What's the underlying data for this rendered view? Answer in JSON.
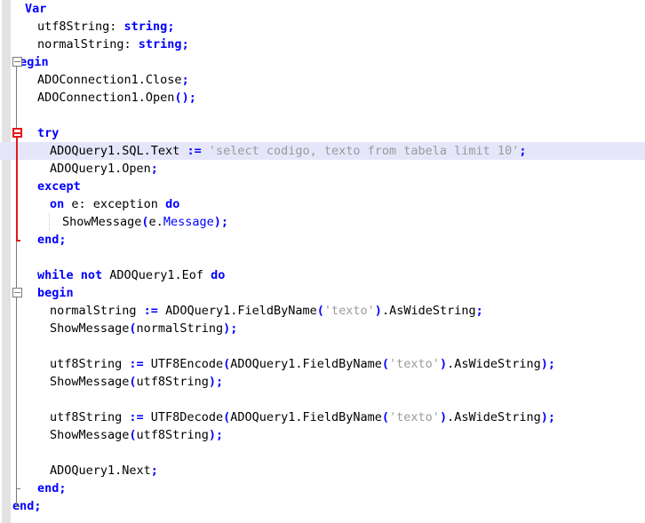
{
  "editor": {
    "name": "code-editor",
    "language": "Delphi / Object Pascal",
    "colors": {
      "background": "#ffffff",
      "gutter": "#e2e2e2",
      "keyword": "#0000ff",
      "string": "#9a9a9a",
      "identifier": "#000000",
      "punctuation": "#0000ff",
      "current_line_highlight": "#e6e6fa",
      "fold_line_gray": "#7a7a7a",
      "fold_line_red": "#e01b1b"
    },
    "highlighted_line_number": 8
  },
  "lines": [
    {
      "n": 1,
      "indent": 1,
      "highlight": false,
      "tokens": [
        {
          "t": "kw",
          "v": "Var"
        }
      ]
    },
    {
      "n": 2,
      "indent": 2,
      "highlight": false,
      "tokens": [
        {
          "t": "id",
          "v": "utf8String: "
        },
        {
          "t": "kw",
          "v": "string"
        },
        {
          "t": "pun",
          "v": ";"
        }
      ]
    },
    {
      "n": 3,
      "indent": 2,
      "highlight": false,
      "tokens": [
        {
          "t": "id",
          "v": "normalString: "
        },
        {
          "t": "kw",
          "v": "string"
        },
        {
          "t": "pun",
          "v": ";"
        }
      ]
    },
    {
      "n": 4,
      "indent": 0,
      "highlight": false,
      "tokens": [
        {
          "t": "kw",
          "v": "begin"
        }
      ]
    },
    {
      "n": 5,
      "indent": 2,
      "highlight": false,
      "tokens": [
        {
          "t": "id",
          "v": "ADOConnection1.Close"
        },
        {
          "t": "pun",
          "v": ";"
        }
      ]
    },
    {
      "n": 6,
      "indent": 2,
      "highlight": false,
      "tokens": [
        {
          "t": "id",
          "v": "ADOConnection1.Open"
        },
        {
          "t": "pun",
          "v": "();"
        }
      ]
    },
    {
      "n": 7,
      "indent": 0,
      "highlight": false,
      "tokens": []
    },
    {
      "n": 8,
      "indent": 2,
      "highlight": false,
      "tokens": [
        {
          "t": "kw",
          "v": "try"
        }
      ]
    },
    {
      "n": 9,
      "indent": 3,
      "highlight": true,
      "tokens": [
        {
          "t": "id",
          "v": "ADOQuery1.SQL.Text "
        },
        {
          "t": "pun",
          "v": ":= "
        },
        {
          "t": "str",
          "v": "'select codigo, texto from tabela limit 10'"
        },
        {
          "t": "pun",
          "v": ";"
        }
      ]
    },
    {
      "n": 10,
      "indent": 3,
      "highlight": false,
      "tokens": [
        {
          "t": "id",
          "v": "ADOQuery1.Open"
        },
        {
          "t": "pun",
          "v": ";"
        }
      ]
    },
    {
      "n": 11,
      "indent": 2,
      "highlight": false,
      "tokens": [
        {
          "t": "kw",
          "v": "except"
        }
      ]
    },
    {
      "n": 12,
      "indent": 3,
      "highlight": false,
      "tokens": [
        {
          "t": "kw",
          "v": "on"
        },
        {
          "t": "id",
          "v": " e: exception "
        },
        {
          "t": "kw",
          "v": "do"
        }
      ]
    },
    {
      "n": 13,
      "indent": 4,
      "highlight": false,
      "tokens": [
        {
          "t": "id",
          "v": "ShowMessage"
        },
        {
          "t": "pun",
          "v": "("
        },
        {
          "t": "id",
          "v": "e."
        },
        {
          "t": "prop",
          "v": "Message"
        },
        {
          "t": "pun",
          "v": ");"
        }
      ]
    },
    {
      "n": 14,
      "indent": 2,
      "highlight": false,
      "tokens": [
        {
          "t": "kw",
          "v": "end"
        },
        {
          "t": "pun",
          "v": ";"
        }
      ]
    },
    {
      "n": 15,
      "indent": 0,
      "highlight": false,
      "tokens": []
    },
    {
      "n": 16,
      "indent": 2,
      "highlight": false,
      "tokens": [
        {
          "t": "kw",
          "v": "while "
        },
        {
          "t": "kw",
          "v": "not "
        },
        {
          "t": "id",
          "v": "ADOQuery1.Eof "
        },
        {
          "t": "kw",
          "v": "do"
        }
      ]
    },
    {
      "n": 17,
      "indent": 2,
      "highlight": false,
      "tokens": [
        {
          "t": "kw",
          "v": "begin"
        }
      ]
    },
    {
      "n": 18,
      "indent": 3,
      "highlight": false,
      "tokens": [
        {
          "t": "id",
          "v": "normalString "
        },
        {
          "t": "pun",
          "v": ":= "
        },
        {
          "t": "id",
          "v": "ADOQuery1.FieldByName"
        },
        {
          "t": "pun",
          "v": "("
        },
        {
          "t": "str",
          "v": "'texto'"
        },
        {
          "t": "pun",
          "v": ")"
        },
        {
          "t": "id",
          "v": ".AsWideString"
        },
        {
          "t": "pun",
          "v": ";"
        }
      ]
    },
    {
      "n": 19,
      "indent": 3,
      "highlight": false,
      "tokens": [
        {
          "t": "id",
          "v": "ShowMessage"
        },
        {
          "t": "pun",
          "v": "("
        },
        {
          "t": "id",
          "v": "normalString"
        },
        {
          "t": "pun",
          "v": ");"
        }
      ]
    },
    {
      "n": 20,
      "indent": 0,
      "highlight": false,
      "tokens": []
    },
    {
      "n": 21,
      "indent": 3,
      "highlight": false,
      "tokens": [
        {
          "t": "id",
          "v": "utf8String "
        },
        {
          "t": "pun",
          "v": ":= "
        },
        {
          "t": "id",
          "v": "UTF8Encode"
        },
        {
          "t": "pun",
          "v": "("
        },
        {
          "t": "id",
          "v": "ADOQuery1.FieldByName"
        },
        {
          "t": "pun",
          "v": "("
        },
        {
          "t": "str",
          "v": "'texto'"
        },
        {
          "t": "pun",
          "v": ")"
        },
        {
          "t": "id",
          "v": ".AsWideString"
        },
        {
          "t": "pun",
          "v": ");"
        }
      ]
    },
    {
      "n": 22,
      "indent": 3,
      "highlight": false,
      "tokens": [
        {
          "t": "id",
          "v": "ShowMessage"
        },
        {
          "t": "pun",
          "v": "("
        },
        {
          "t": "id",
          "v": "utf8String"
        },
        {
          "t": "pun",
          "v": ");"
        }
      ]
    },
    {
      "n": 23,
      "indent": 0,
      "highlight": false,
      "tokens": []
    },
    {
      "n": 24,
      "indent": 3,
      "highlight": false,
      "tokens": [
        {
          "t": "id",
          "v": "utf8String "
        },
        {
          "t": "pun",
          "v": ":= "
        },
        {
          "t": "id",
          "v": "UTF8Decode"
        },
        {
          "t": "pun",
          "v": "("
        },
        {
          "t": "id",
          "v": "ADOQuery1.FieldByName"
        },
        {
          "t": "pun",
          "v": "("
        },
        {
          "t": "str",
          "v": "'texto'"
        },
        {
          "t": "pun",
          "v": ")"
        },
        {
          "t": "id",
          "v": ".AsWideString"
        },
        {
          "t": "pun",
          "v": ");"
        }
      ]
    },
    {
      "n": 25,
      "indent": 3,
      "highlight": false,
      "tokens": [
        {
          "t": "id",
          "v": "ShowMessage"
        },
        {
          "t": "pun",
          "v": "("
        },
        {
          "t": "id",
          "v": "utf8String"
        },
        {
          "t": "pun",
          "v": ");"
        }
      ]
    },
    {
      "n": 26,
      "indent": 0,
      "highlight": false,
      "tokens": []
    },
    {
      "n": 27,
      "indent": 3,
      "highlight": false,
      "tokens": [
        {
          "t": "id",
          "v": "ADOQuery1.Next"
        },
        {
          "t": "pun",
          "v": ";"
        }
      ]
    },
    {
      "n": 28,
      "indent": 2,
      "highlight": false,
      "tokens": [
        {
          "t": "kw",
          "v": "end"
        },
        {
          "t": "pun",
          "v": ";"
        }
      ]
    },
    {
      "n": 29,
      "indent": 0,
      "highlight": false,
      "tokens": [
        {
          "t": "kw",
          "v": "end"
        },
        {
          "t": "pun",
          "v": ";"
        }
      ]
    }
  ],
  "fold_markers": [
    {
      "name": "fold-marker-begin-outer",
      "line": 4,
      "color": "gray",
      "state": "expanded",
      "symbol": "-"
    },
    {
      "name": "fold-marker-try",
      "line": 8,
      "color": "red",
      "state": "expanded",
      "symbol": "-"
    },
    {
      "name": "fold-marker-begin-inner",
      "line": 17,
      "color": "gray",
      "state": "expanded",
      "symbol": "-"
    }
  ],
  "fold_lines": [
    {
      "name": "fold-line-begin-outer",
      "color": "gray",
      "from_line": 4,
      "to_line": 29
    },
    {
      "name": "fold-line-try",
      "color": "red",
      "from_line": 8,
      "to_line": 14
    },
    {
      "name": "fold-line-begin-inner",
      "color": "gray",
      "color2": "gray",
      "from_line": 17,
      "to_line": 28
    }
  ],
  "indent_guides": [
    {
      "name": "indent-guide-except-body",
      "from_line": 13,
      "to_line": 13,
      "indent": 3
    }
  ]
}
